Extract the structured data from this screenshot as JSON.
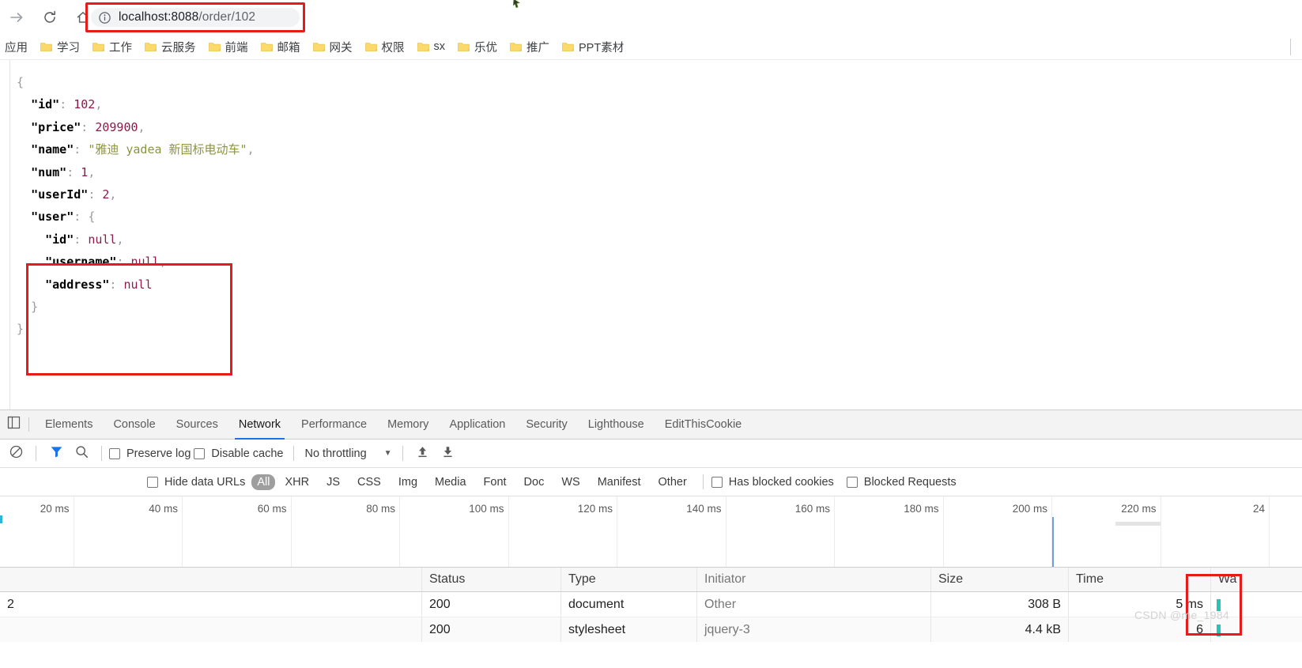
{
  "browser": {
    "nav": {
      "forward_icon": "arrow-right-icon",
      "reload_icon": "reload-icon",
      "home_icon": "home-icon"
    },
    "omnibox": {
      "info_icon": "info-circle-icon",
      "host": "localhost:8088",
      "path": "/order/102",
      "full_url": "localhost:8088/order/102",
      "highlight_color": "#e81b1b"
    },
    "bookmarks": {
      "apps_label": "应用",
      "folder_icon": "folder-icon",
      "items": [
        {
          "label": "学习"
        },
        {
          "label": "工作"
        },
        {
          "label": "云服务"
        },
        {
          "label": "前端"
        },
        {
          "label": "邮箱"
        },
        {
          "label": "网关"
        },
        {
          "label": "权限"
        },
        {
          "label": "sx"
        },
        {
          "label": "乐优"
        },
        {
          "label": "推广"
        },
        {
          "label": "PPT素材"
        }
      ]
    }
  },
  "page": {
    "json_lines": [
      {
        "indent": 0,
        "tokens": [
          {
            "t": "brace",
            "v": "{"
          }
        ]
      },
      {
        "indent": 1,
        "tokens": [
          {
            "t": "key",
            "v": "\"id\""
          },
          {
            "t": "punc",
            "v": ": "
          },
          {
            "t": "num",
            "v": "102"
          },
          {
            "t": "punc",
            "v": ","
          }
        ]
      },
      {
        "indent": 1,
        "tokens": [
          {
            "t": "key",
            "v": "\"price\""
          },
          {
            "t": "punc",
            "v": ": "
          },
          {
            "t": "num",
            "v": "209900"
          },
          {
            "t": "punc",
            "v": ","
          }
        ]
      },
      {
        "indent": 1,
        "tokens": [
          {
            "t": "key",
            "v": "\"name\""
          },
          {
            "t": "punc",
            "v": ": "
          },
          {
            "t": "str",
            "v": "\"雅迪 yadea 新国标电动车\""
          },
          {
            "t": "punc",
            "v": ","
          }
        ]
      },
      {
        "indent": 1,
        "tokens": [
          {
            "t": "key",
            "v": "\"num\""
          },
          {
            "t": "punc",
            "v": ": "
          },
          {
            "t": "num",
            "v": "1"
          },
          {
            "t": "punc",
            "v": ","
          }
        ]
      },
      {
        "indent": 1,
        "tokens": [
          {
            "t": "key",
            "v": "\"userId\""
          },
          {
            "t": "punc",
            "v": ": "
          },
          {
            "t": "num",
            "v": "2"
          },
          {
            "t": "punc",
            "v": ","
          }
        ]
      },
      {
        "indent": 1,
        "tokens": [
          {
            "t": "key",
            "v": "\"user\""
          },
          {
            "t": "punc",
            "v": ": "
          },
          {
            "t": "brace",
            "v": "{"
          }
        ]
      },
      {
        "indent": 2,
        "tokens": [
          {
            "t": "key",
            "v": "\"id\""
          },
          {
            "t": "punc",
            "v": ": "
          },
          {
            "t": "null",
            "v": "null"
          },
          {
            "t": "punc",
            "v": ","
          }
        ]
      },
      {
        "indent": 2,
        "tokens": [
          {
            "t": "key",
            "v": "\"username\""
          },
          {
            "t": "punc",
            "v": ": "
          },
          {
            "t": "null",
            "v": "null"
          },
          {
            "t": "punc",
            "v": ","
          }
        ]
      },
      {
        "indent": 2,
        "tokens": [
          {
            "t": "key",
            "v": "\"address\""
          },
          {
            "t": "punc",
            "v": ": "
          },
          {
            "t": "null",
            "v": "null"
          }
        ]
      },
      {
        "indent": 1,
        "tokens": [
          {
            "t": "brace",
            "v": "}"
          }
        ]
      },
      {
        "indent": 0,
        "tokens": [
          {
            "t": "brace",
            "v": "}"
          }
        ]
      }
    ],
    "highlight_color": "#e81b1b"
  },
  "devtools": {
    "inspect_icon": "inspect-element-icon",
    "tabs": [
      {
        "label": "Elements",
        "active": false
      },
      {
        "label": "Console",
        "active": false
      },
      {
        "label": "Sources",
        "active": false
      },
      {
        "label": "Network",
        "active": true
      },
      {
        "label": "Performance",
        "active": false
      },
      {
        "label": "Memory",
        "active": false
      },
      {
        "label": "Application",
        "active": false
      },
      {
        "label": "Security",
        "active": false
      },
      {
        "label": "Lighthouse",
        "active": false
      },
      {
        "label": "EditThisCookie",
        "active": false
      }
    ],
    "active_tab_color": "#1a73e8",
    "toolbar": {
      "clear_icon": "clear-circle-slash-icon",
      "filter_icon": "funnel-filter-icon",
      "filter_active_color": "#1a73e8",
      "search_icon": "search-icon",
      "preserve_log_label": "Preserve log",
      "preserve_log_checked": false,
      "disable_cache_label": "Disable cache",
      "disable_cache_checked": false,
      "throttling_value": "No throttling",
      "throttling_caret": "chevron-down-icon",
      "import_icon": "import-har-icon",
      "export_icon": "export-har-icon"
    },
    "filterbar": {
      "hide_data_urls_label": "Hide data URLs",
      "hide_data_urls_checked": false,
      "types": [
        "All",
        "XHR",
        "JS",
        "CSS",
        "Img",
        "Media",
        "Font",
        "Doc",
        "WS",
        "Manifest",
        "Other"
      ],
      "selected_type": "All",
      "has_blocked_cookies_label": "Has blocked cookies",
      "has_blocked_cookies_checked": false,
      "blocked_requests_label": "Blocked Requests",
      "blocked_requests_checked": false
    },
    "overview": {
      "ticks": [
        "20 ms",
        "40 ms",
        "60 ms",
        "80 ms",
        "100 ms",
        "120 ms",
        "140 ms",
        "160 ms",
        "180 ms",
        "200 ms",
        "220 ms",
        "24"
      ],
      "marker_color": "#6c9fe0"
    },
    "requests_table": {
      "columns": [
        "",
        "Status",
        "Type",
        "Initiator",
        "Size",
        "Time",
        "Wa"
      ],
      "rows": [
        {
          "name": "2",
          "status": "200",
          "type": "document",
          "initiator": "Other",
          "size": "308 B",
          "time": "5 ms"
        },
        {
          "name": "",
          "status": "200",
          "type": "stylesheet",
          "initiator": "jquery-3",
          "size": "4.4 kB",
          "time": "6"
        }
      ],
      "time_highlight_color": "#e81b1b"
    },
    "watermark": "CSDN @me_1984"
  }
}
